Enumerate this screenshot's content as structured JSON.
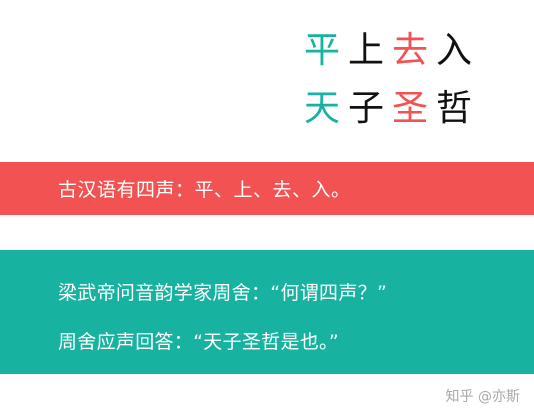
{
  "tones": {
    "row1": [
      "平",
      "上",
      "去",
      "入"
    ],
    "row2": [
      "天",
      "子",
      "圣",
      "哲"
    ]
  },
  "colors": {
    "teal": "#17b2a0",
    "black": "#111111",
    "red": "#f25251",
    "white": "#ffffff",
    "watermark": "#a8a8a8"
  },
  "red_banner": {
    "text": "古汉语有四声：平、上、去、入。"
  },
  "teal_banner": {
    "line1": "梁武帝问音韵学家周舍：“何谓四声？”",
    "line2": "周舍应声回答：“天子圣哲是也。”"
  },
  "watermark": {
    "text": "知乎 @亦斯"
  }
}
